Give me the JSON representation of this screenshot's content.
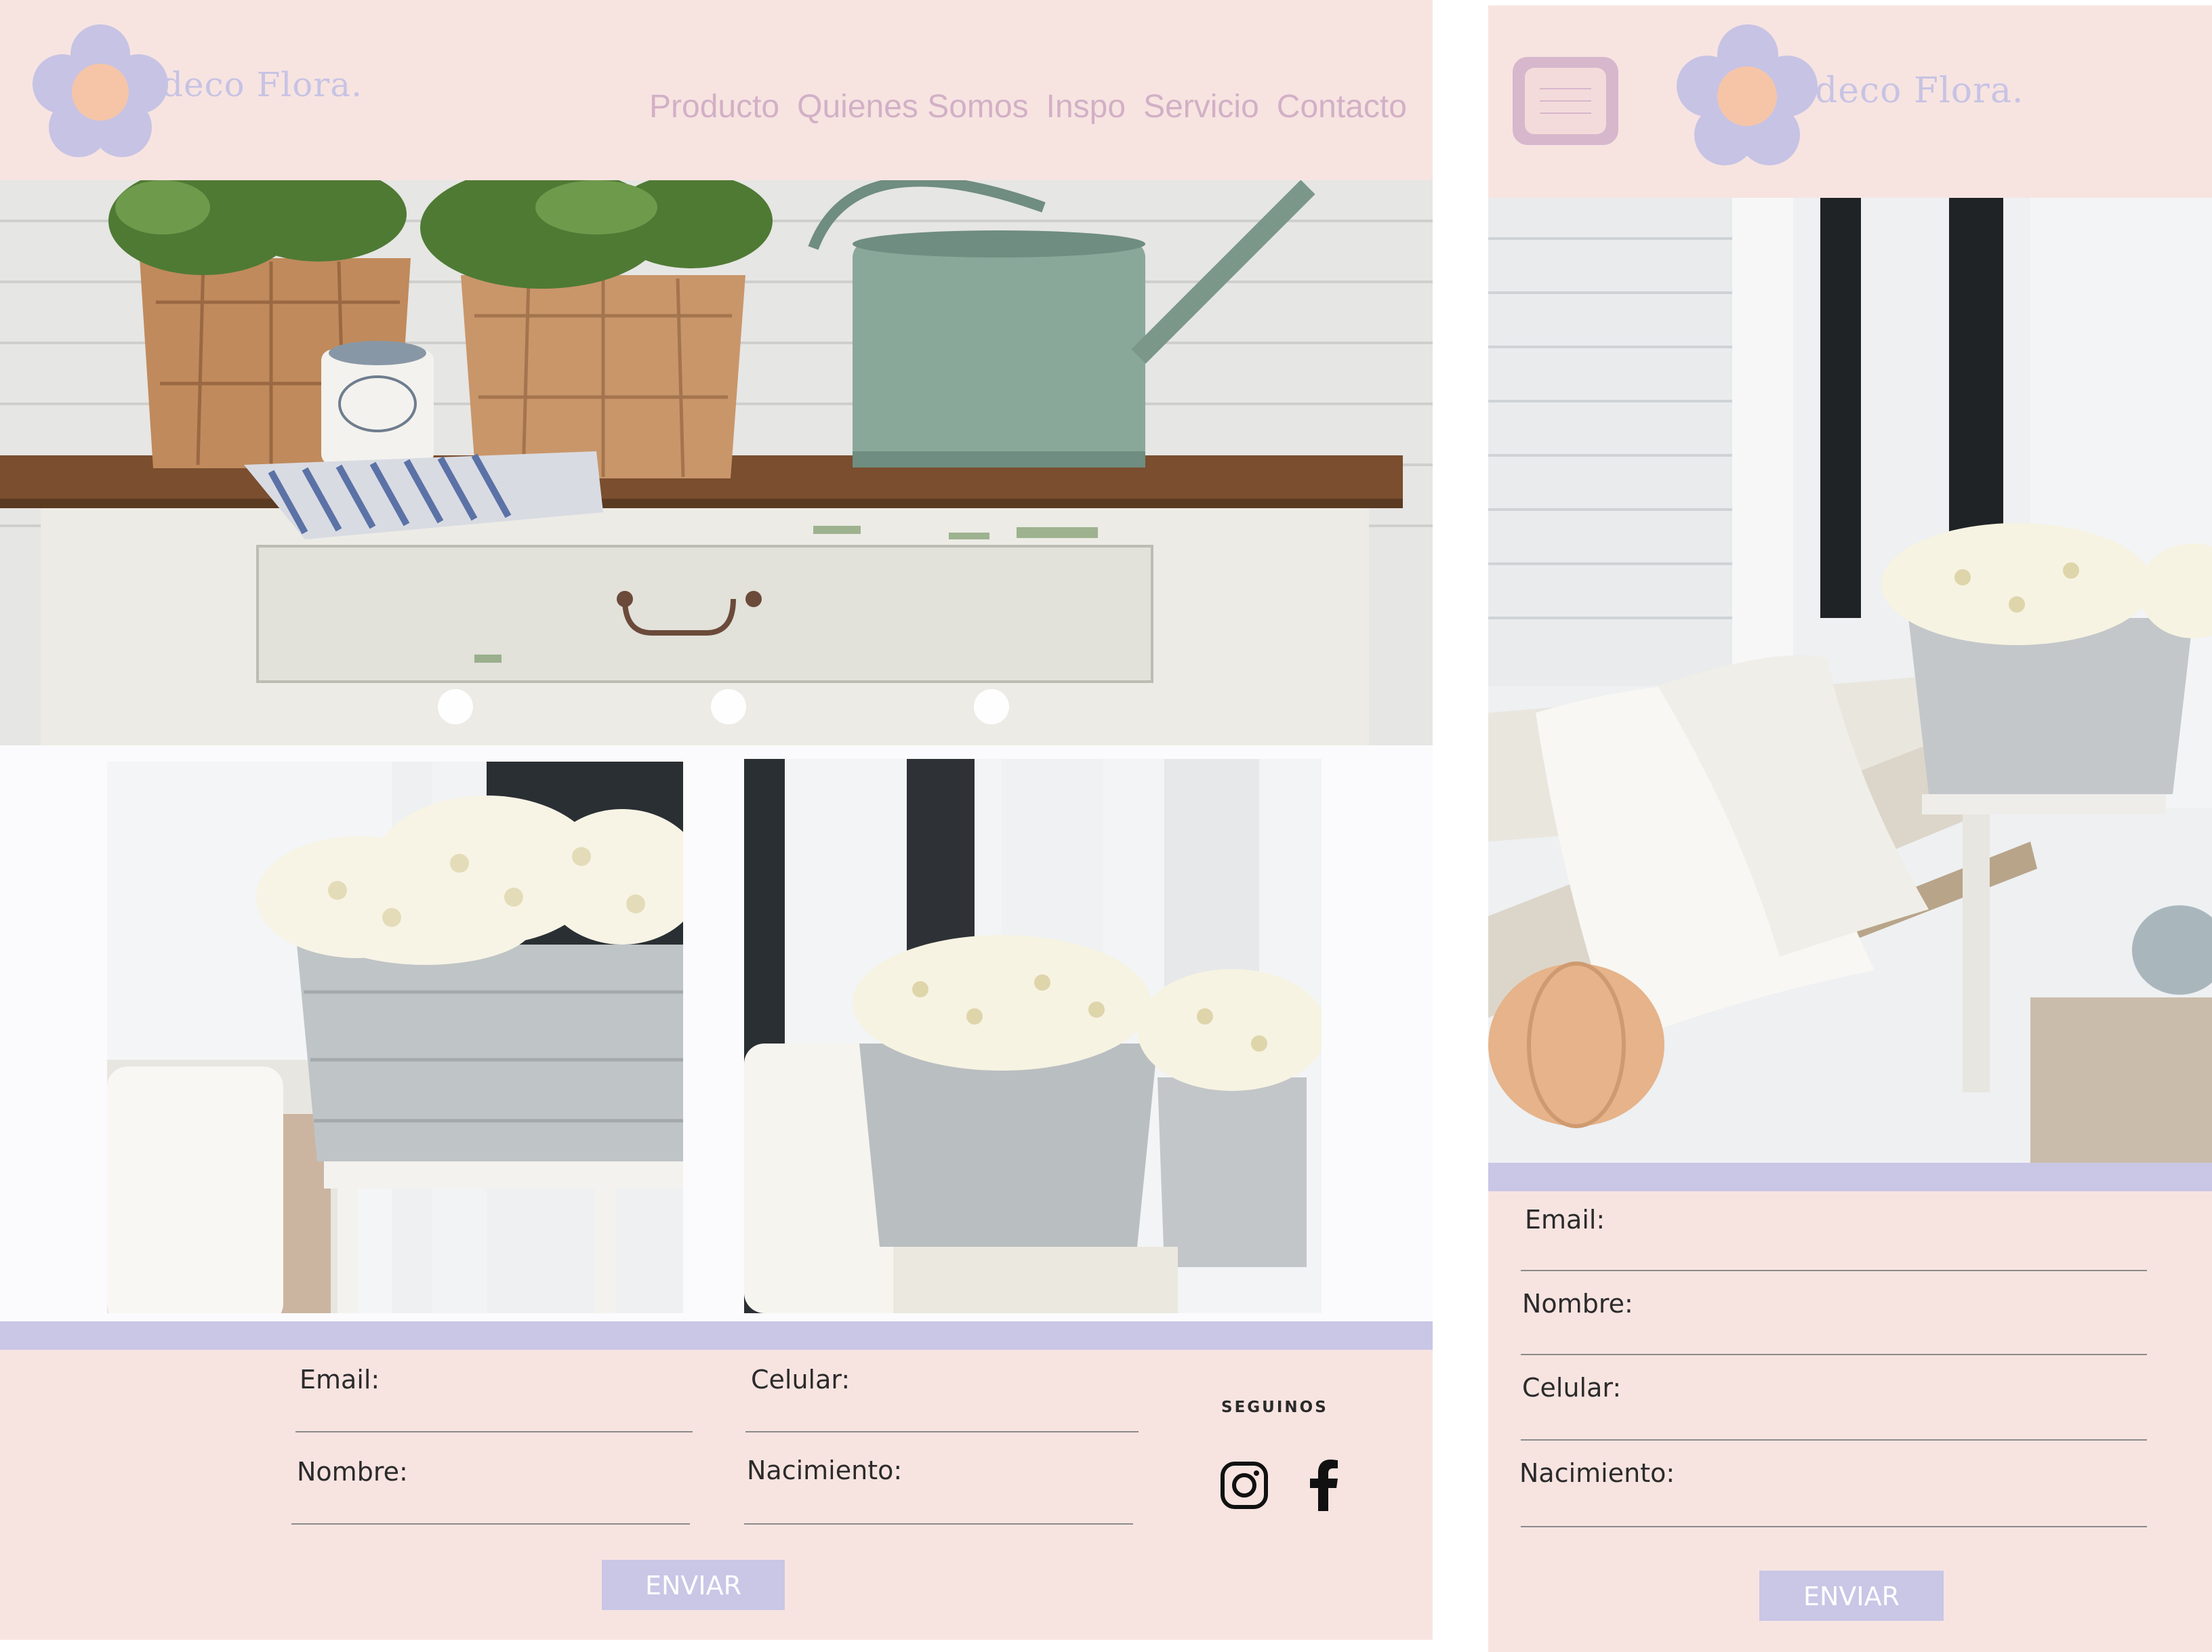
{
  "brand": {
    "logo_text": "deco Flora.",
    "flower_petal_color": "#c7c3e4",
    "flower_center_color": "#f6c5a8"
  },
  "nav": {
    "items": [
      {
        "label": "Producto"
      },
      {
        "label": "Quienes Somos"
      },
      {
        "label": "Inspo"
      },
      {
        "label": "Servicio"
      },
      {
        "label": "Contacto"
      }
    ]
  },
  "hero": {
    "slides_total": 3
  },
  "form": {
    "email_label": "Email:",
    "celular_label": "Celular:",
    "nombre_label": "Nombre:",
    "nacimiento_label": "Nacimiento:",
    "submit_label": "ENVIAR"
  },
  "social": {
    "heading": "SEGUINOS",
    "icons": [
      "instagram-icon",
      "facebook-icon"
    ]
  },
  "mobile": {
    "logo_text": "deco Flora.",
    "menu_icon": "hamburger-menu-icon",
    "form": {
      "email_label": "Email:",
      "nombre_label": "Nombre:",
      "celular_label": "Celular:",
      "nacimiento_label": "Nacimiento:",
      "submit_label": "ENVIAR"
    }
  },
  "colors": {
    "header_bg": "#f7e4e1",
    "accent_lavender": "#c9c6e6",
    "nav_text": "#d2b0c6",
    "page_bg": "#fbfbfd"
  }
}
